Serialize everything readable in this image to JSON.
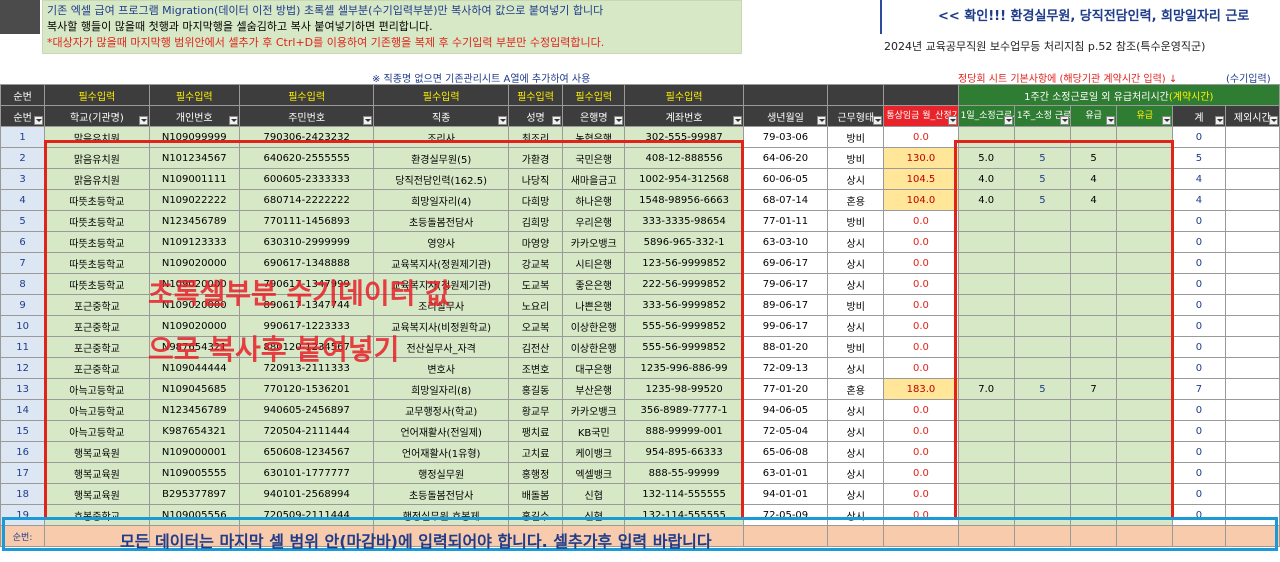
{
  "notes": {
    "line1": "기존 엑셀 급여 프로그램 Migration(데이터 이전 방법) 초록셀 셀부분(수기입력부분)만 복사하여 값으로 붙여넣기 합니다",
    "line2": "복사할 행들이 많을때 첫행과 마지막행을 셀숨김하고 복사 붙여넣기하면 편리합니다.",
    "line3": "*대상자가 많을때 마지막행 범위안에서 셀추가 후 Ctrl+D를 이용하여 기존행을 복제 후 수기입력 부분만 수정입력합니다."
  },
  "check_banner": "<< 확인!!!  환경실무원, 당직전담인력, 희망일자리 근로",
  "reference": "2024년 교육공무직원 보수업무등 처리지침 p.52 참조(특수운영직군)",
  "note_col_a": "※ 직종명 없으면 기존관리시트 A열에 추가하여 사용",
  "note_basic": "정당회 시트 기본사항에 (해당기관 계약시간 입력) ↓",
  "note_manual": "(수기입력)",
  "header1": {
    "seq": "순번",
    "req": "필수입력",
    "weekly": "1주간 소정근로일 외 유급처리시간",
    "weekly_sub": "(계약시간)"
  },
  "header2": {
    "seq": "순번",
    "school": "학교(기관명)",
    "personal_no": "개인번호",
    "rrn": "주민번호",
    "job": "직종",
    "name": "성명",
    "bank": "은행명",
    "account": "계좌번호",
    "birth": "생년월일",
    "work_type": "근무형태",
    "wage": "통상임금 월_산정기준",
    "day_hours": "1일_소정근로시간 (월~금)",
    "week_days": "1주_소정 근로일 (월~금)",
    "paid": "유급",
    "paid2": "유급",
    "total": "계",
    "excluded": "제외시간"
  },
  "rows": [
    {
      "no": "1",
      "school": "맑음유치원",
      "pno": "N109099999",
      "rrn": "790306-2423232",
      "job": "조리사",
      "name": "최조리",
      "bank": "농협은행",
      "acct": "302-555-99987",
      "birth": "79-03-06",
      "type": "방비",
      "wage": "0.0",
      "h": "",
      "d": "",
      "p": "",
      "p2": "",
      "tot": "0"
    },
    {
      "no": "2",
      "school": "맑음유치원",
      "pno": "N101234567",
      "rrn": "640620-2555555",
      "job": "환경실무원(5)",
      "name": "가환경",
      "bank": "국민은행",
      "acct": "408-12-888556",
      "birth": "64-06-20",
      "type": "방비",
      "wage": "130.0",
      "h": "5.0",
      "d": "5",
      "p": "5",
      "p2": "",
      "tot": "5"
    },
    {
      "no": "3",
      "school": "맑음유치원",
      "pno": "N109001111",
      "rrn": "600605-2333333",
      "job": "당직전담인력(162.5)",
      "name": "나당직",
      "bank": "새마을금고",
      "acct": "1002-954-312568",
      "birth": "60-06-05",
      "type": "상시",
      "wage": "104.5",
      "h": "4.0",
      "d": "5",
      "p": "4",
      "p2": "",
      "tot": "4"
    },
    {
      "no": "4",
      "school": "따뜻초등학교",
      "pno": "N109022222",
      "rrn": "680714-2222222",
      "job": "희망일자리(4)",
      "name": "다희망",
      "bank": "하나은행",
      "acct": "1548-98956-6663",
      "birth": "68-07-14",
      "type": "혼용",
      "wage": "104.0",
      "h": "4.0",
      "d": "5",
      "p": "4",
      "p2": "",
      "tot": "4"
    },
    {
      "no": "5",
      "school": "따뜻초등학교",
      "pno": "N123456789",
      "rrn": "770111-1456893",
      "job": "초등돌봄전담사",
      "name": "김희망",
      "bank": "우리은행",
      "acct": "333-3335-98654",
      "birth": "77-01-11",
      "type": "방비",
      "wage": "0.0",
      "h": "",
      "d": "",
      "p": "",
      "p2": "",
      "tot": "0"
    },
    {
      "no": "6",
      "school": "따뜻초등학교",
      "pno": "N109123333",
      "rrn": "630310-2999999",
      "job": "영양사",
      "name": "마영양",
      "bank": "카카오뱅크",
      "acct": "5896-965-332-1",
      "birth": "63-03-10",
      "type": "상시",
      "wage": "0.0",
      "h": "",
      "d": "",
      "p": "",
      "p2": "",
      "tot": "0"
    },
    {
      "no": "7",
      "school": "따뜻초등학교",
      "pno": "N109020000",
      "rrn": "690617-1348888",
      "job": "교육복지사(정원제기관)",
      "name": "강교복",
      "bank": "시티은행",
      "acct": "123-56-9999852",
      "birth": "69-06-17",
      "type": "상시",
      "wage": "0.0",
      "h": "",
      "d": "",
      "p": "",
      "p2": "",
      "tot": "0"
    },
    {
      "no": "8",
      "school": "따뜻초등학교",
      "pno": "N109020000",
      "rrn": "790617-1347999",
      "job": "교육복지사(정원제기관)",
      "name": "도교복",
      "bank": "좋은은행",
      "acct": "222-56-9999852",
      "birth": "79-06-17",
      "type": "상시",
      "wage": "0.0",
      "h": "",
      "d": "",
      "p": "",
      "p2": "",
      "tot": "0"
    },
    {
      "no": "9",
      "school": "포근중학교",
      "pno": "N109020000",
      "rrn": "890617-1347744",
      "job": "조리실무사",
      "name": "노요리",
      "bank": "나쁜은행",
      "acct": "333-56-9999852",
      "birth": "89-06-17",
      "type": "방비",
      "wage": "0.0",
      "h": "",
      "d": "",
      "p": "",
      "p2": "",
      "tot": "0"
    },
    {
      "no": "10",
      "school": "포근중학교",
      "pno": "N109020000",
      "rrn": "990617-1223333",
      "job": "교육복지사(비정원학교)",
      "name": "오교복",
      "bank": "이상한은행",
      "acct": "555-56-9999852",
      "birth": "99-06-17",
      "type": "상시",
      "wage": "0.0",
      "h": "",
      "d": "",
      "p": "",
      "p2": "",
      "tot": "0"
    },
    {
      "no": "11",
      "school": "포근중학교",
      "pno": "N987654321",
      "rrn": "880120-1234567",
      "job": "전산실무사_자격",
      "name": "김전산",
      "bank": "이상한은행",
      "acct": "555-56-9999852",
      "birth": "88-01-20",
      "type": "방비",
      "wage": "0.0",
      "h": "",
      "d": "",
      "p": "",
      "p2": "",
      "tot": "0"
    },
    {
      "no": "12",
      "school": "포근중학교",
      "pno": "N109044444",
      "rrn": "720913-2111333",
      "job": "변호사",
      "name": "조변호",
      "bank": "대구은행",
      "acct": "1235-996-886-99",
      "birth": "72-09-13",
      "type": "상시",
      "wage": "0.0",
      "h": "",
      "d": "",
      "p": "",
      "p2": "",
      "tot": "0"
    },
    {
      "no": "13",
      "school": "아늑고등학교",
      "pno": "N109045685",
      "rrn": "770120-1536201",
      "job": "희망일자리(8)",
      "name": "홍길동",
      "bank": "부산은행",
      "acct": "1235-98-99520",
      "birth": "77-01-20",
      "type": "혼용",
      "wage": "183.0",
      "h": "7.0",
      "d": "5",
      "p": "7",
      "p2": "",
      "tot": "7"
    },
    {
      "no": "14",
      "school": "아늑고등학교",
      "pno": "N123456789",
      "rrn": "940605-2456897",
      "job": "교무행정사(학교)",
      "name": "황교무",
      "bank": "카카오뱅크",
      "acct": "356-8989-7777-1",
      "birth": "94-06-05",
      "type": "상시",
      "wage": "0.0",
      "h": "",
      "d": "",
      "p": "",
      "p2": "",
      "tot": "0"
    },
    {
      "no": "15",
      "school": "아늑고등학교",
      "pno": "K987654321",
      "rrn": "720504-2111444",
      "job": "언어재활사(전일제)",
      "name": "팽치료",
      "bank": "KB국민",
      "acct": "888-99999-001",
      "birth": "72-05-04",
      "type": "상시",
      "wage": "0.0",
      "h": "",
      "d": "",
      "p": "",
      "p2": "",
      "tot": "0"
    },
    {
      "no": "16",
      "school": "행복교육원",
      "pno": "N109000001",
      "rrn": "650608-1234567",
      "job": "언어재활사(1유형)",
      "name": "고치료",
      "bank": "케이뱅크",
      "acct": "954-895-66333",
      "birth": "65-06-08",
      "type": "상시",
      "wage": "0.0",
      "h": "",
      "d": "",
      "p": "",
      "p2": "",
      "tot": "0"
    },
    {
      "no": "17",
      "school": "행복교육원",
      "pno": "N109005555",
      "rrn": "630101-1777777",
      "job": "행정실무원",
      "name": "홍행정",
      "bank": "엑셀뱅크",
      "acct": "888-55-99999",
      "birth": "63-01-01",
      "type": "상시",
      "wage": "0.0",
      "h": "",
      "d": "",
      "p": "",
      "p2": "",
      "tot": "0"
    },
    {
      "no": "18",
      "school": "행복교육원",
      "pno": "B295377897",
      "rrn": "940101-2568994",
      "job": "초등돌봄전담사",
      "name": "배돌봄",
      "bank": "신협",
      "acct": "132-114-555555",
      "birth": "94-01-01",
      "type": "상시",
      "wage": "0.0",
      "h": "",
      "d": "",
      "p": "",
      "p2": "",
      "tot": "0"
    },
    {
      "no": "19",
      "school": "호봉중학교",
      "pno": "N109005556",
      "rrn": "720509-2111444",
      "job": "행정실무원 호봉제",
      "name": "홍길수",
      "bank": "신협",
      "acct": "132-114-555555",
      "birth": "72-05-09",
      "type": "상시",
      "wage": "0.0",
      "h": "",
      "d": "",
      "p": "",
      "p2": "",
      "tot": "0"
    }
  ],
  "last_row_label": "순번:",
  "overlay_text1": "초록셀부분 수기데이터 값",
  "overlay_text2": "으로 복사후 붙여넣기",
  "bottom_message": "모든 데이터는 마지막 셀 범위 안(마감바)에 입력되어야 합니다. 셀추가후 입력 바랍니다"
}
